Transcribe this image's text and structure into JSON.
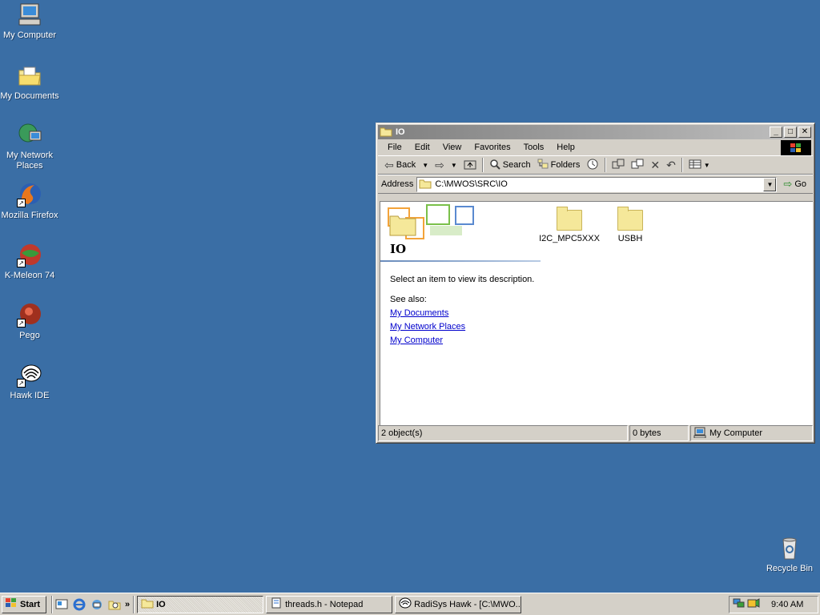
{
  "desktop": {
    "icons": [
      {
        "label": "My Computer",
        "icon": "computer-icon"
      },
      {
        "label": "My Documents",
        "icon": "documents-folder-icon"
      },
      {
        "label": "My Network Places",
        "icon": "network-places-icon"
      },
      {
        "label": "Mozilla Firefox",
        "icon": "firefox-icon"
      },
      {
        "label": "K-Meleon 74",
        "icon": "k-meleon-icon"
      },
      {
        "label": "Pego",
        "icon": "pego-icon"
      },
      {
        "label": "Hawk IDE",
        "icon": "hawk-ide-icon"
      },
      {
        "label": "Recycle Bin",
        "icon": "recycle-bin-icon"
      }
    ]
  },
  "window": {
    "title": "IO",
    "menu": [
      "File",
      "Edit",
      "View",
      "Favorites",
      "Tools",
      "Help"
    ],
    "toolbar": {
      "back_label": "Back",
      "search_label": "Search",
      "folders_label": "Folders"
    },
    "address": {
      "label": "Address",
      "value": "C:\\MWOS\\SRC\\IO",
      "go_label": "Go"
    },
    "panel": {
      "heading": "IO",
      "description": "Select an item to view its description.",
      "see_also": "See also:",
      "links": [
        "My Documents",
        "My Network Places",
        "My Computer"
      ]
    },
    "items": [
      {
        "name": "I2C_MPC5XXX"
      },
      {
        "name": "USBH"
      }
    ],
    "status": {
      "objects": "2 object(s)",
      "size": "0 bytes",
      "zone": "My Computer"
    }
  },
  "taskbar": {
    "start_label": "Start",
    "tasks": [
      {
        "label": "IO",
        "active": true
      },
      {
        "label": "threads.h - Notepad",
        "active": false
      },
      {
        "label": "RadiSys Hawk - [C:\\MWO...",
        "active": false
      }
    ],
    "clock": "9:40 AM"
  },
  "colors": {
    "desktop": "#3a6ea5",
    "face": "#d4d0c8",
    "link": "#0000cc"
  }
}
